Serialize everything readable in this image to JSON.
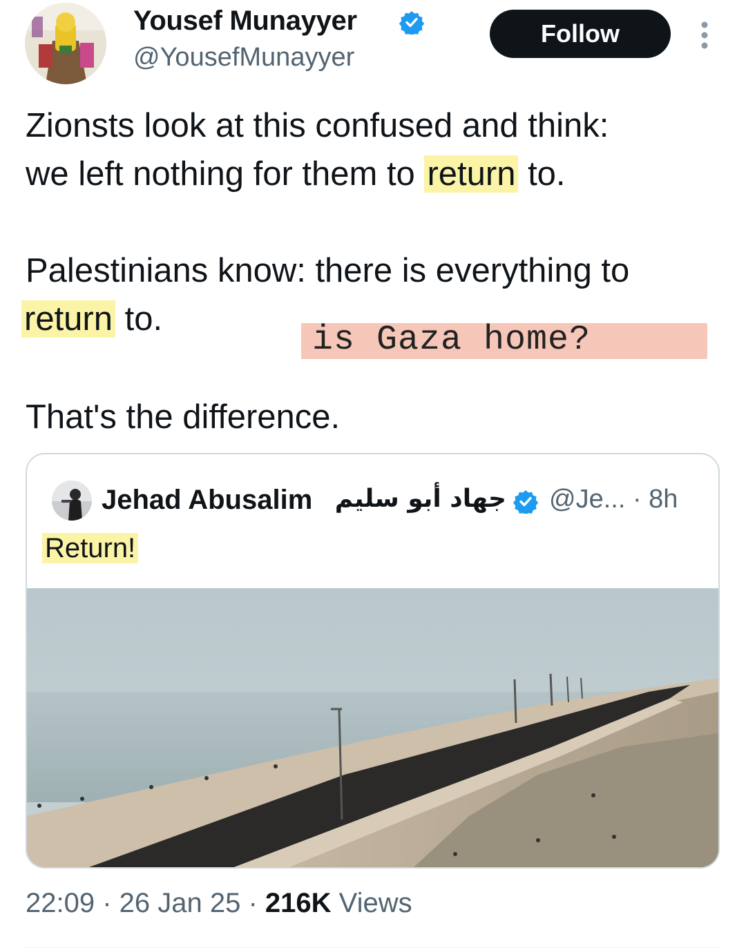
{
  "author": {
    "name": "Yousef Munayyer",
    "handle": "@YousefMunayyer",
    "verified": true
  },
  "follow_label": "Follow",
  "tweet": {
    "line1": "Zionsts look at this confused and think:",
    "line2_pre": "we left nothing for them to ",
    "line2_hl": "return",
    "line2_post": " to.",
    "line3": "Palestinians know: there is everything to",
    "line4_hl": "return",
    "line4_post": " to.",
    "line5": "That's the difference."
  },
  "annotation": "is Gaza home?",
  "quote": {
    "name": "Jehad Abusalim",
    "name_arabic": "جهاد أبو سليم",
    "handle_time": "@Je... · 8h",
    "text": "Return!"
  },
  "footer": {
    "time_date": "22:09 · 26 Jan 25 · ",
    "views_count": "216K",
    "views_label": " Views"
  },
  "colors": {
    "highlight_yellow": "#fbf3a6",
    "annotation_pink": "#f6c6b9",
    "verified_blue": "#1d9bf0",
    "follow_button": "#0f1419"
  },
  "icons": [
    "verified-badge-icon",
    "more-options-icon"
  ]
}
